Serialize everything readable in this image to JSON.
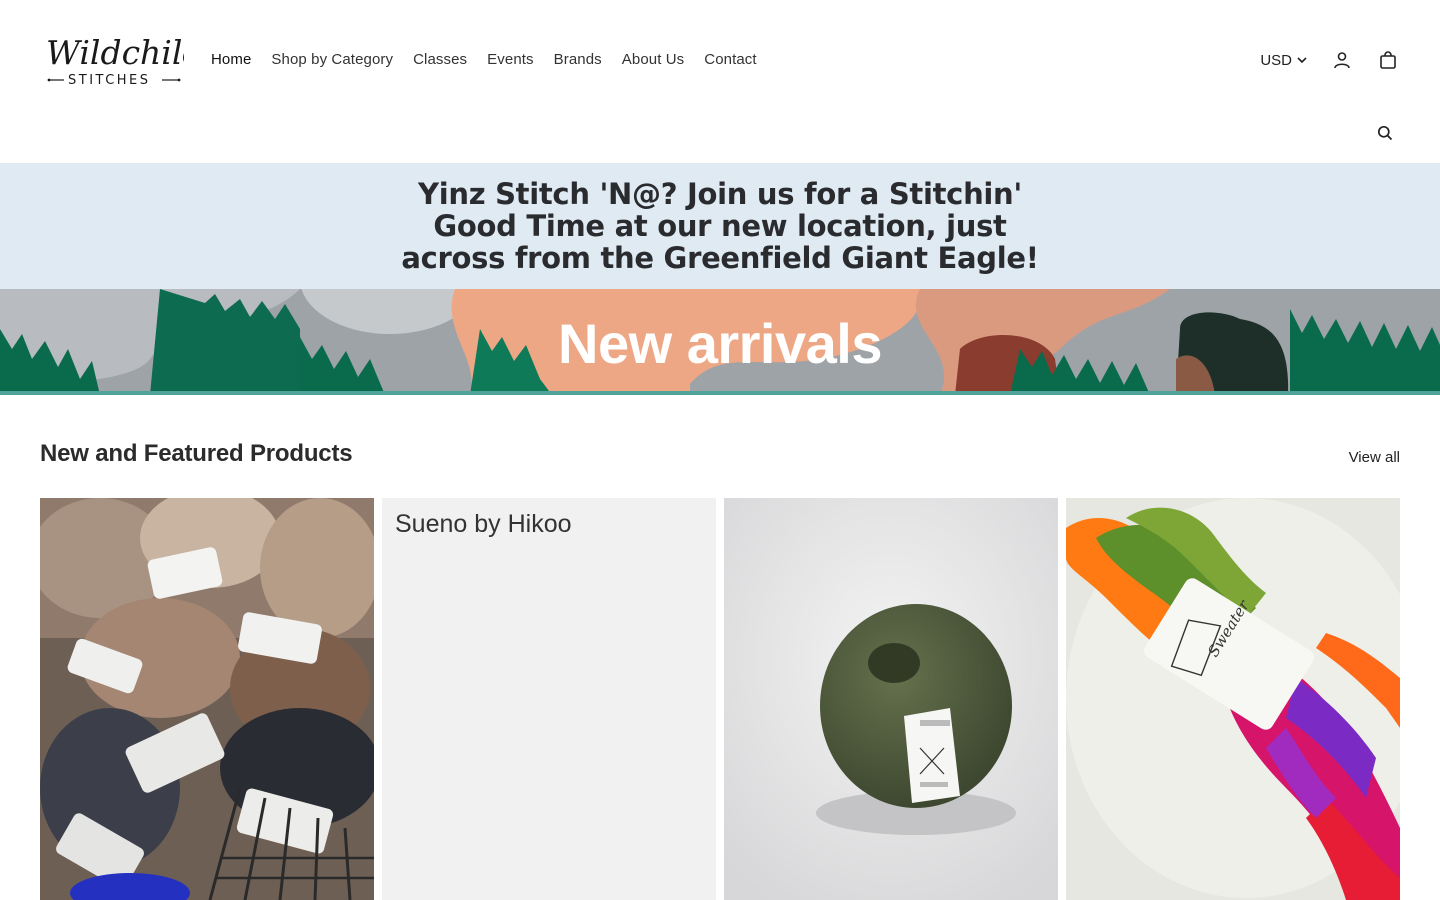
{
  "brand": {
    "logo_line1": "Wildchild",
    "logo_line2": "STITCHES"
  },
  "nav": [
    {
      "label": "Home"
    },
    {
      "label": "Shop by Category"
    },
    {
      "label": "Classes"
    },
    {
      "label": "Events"
    },
    {
      "label": "Brands"
    },
    {
      "label": "About Us"
    },
    {
      "label": "Contact"
    }
  ],
  "utils": {
    "currency": "USD",
    "icons": [
      "account-icon",
      "cart-icon",
      "search-icon"
    ]
  },
  "announcement": {
    "text": "Yinz Stitch 'N@? Join us for a Stitchin' Good Time at our new location, just across from the Greenfield Giant Eagle!",
    "bg_color": "#dfeaf3"
  },
  "hero": {
    "title": "New arrivals"
  },
  "featured": {
    "title": "New and Featured Products",
    "view_all": "View all",
    "products": [
      {
        "image": "skeins-brown-white"
      },
      {
        "title": "Sueno by Hikoo",
        "image": "placeholder"
      },
      {
        "image": "green-yarn-ball"
      },
      {
        "image": "rainbow-hank"
      }
    ]
  }
}
